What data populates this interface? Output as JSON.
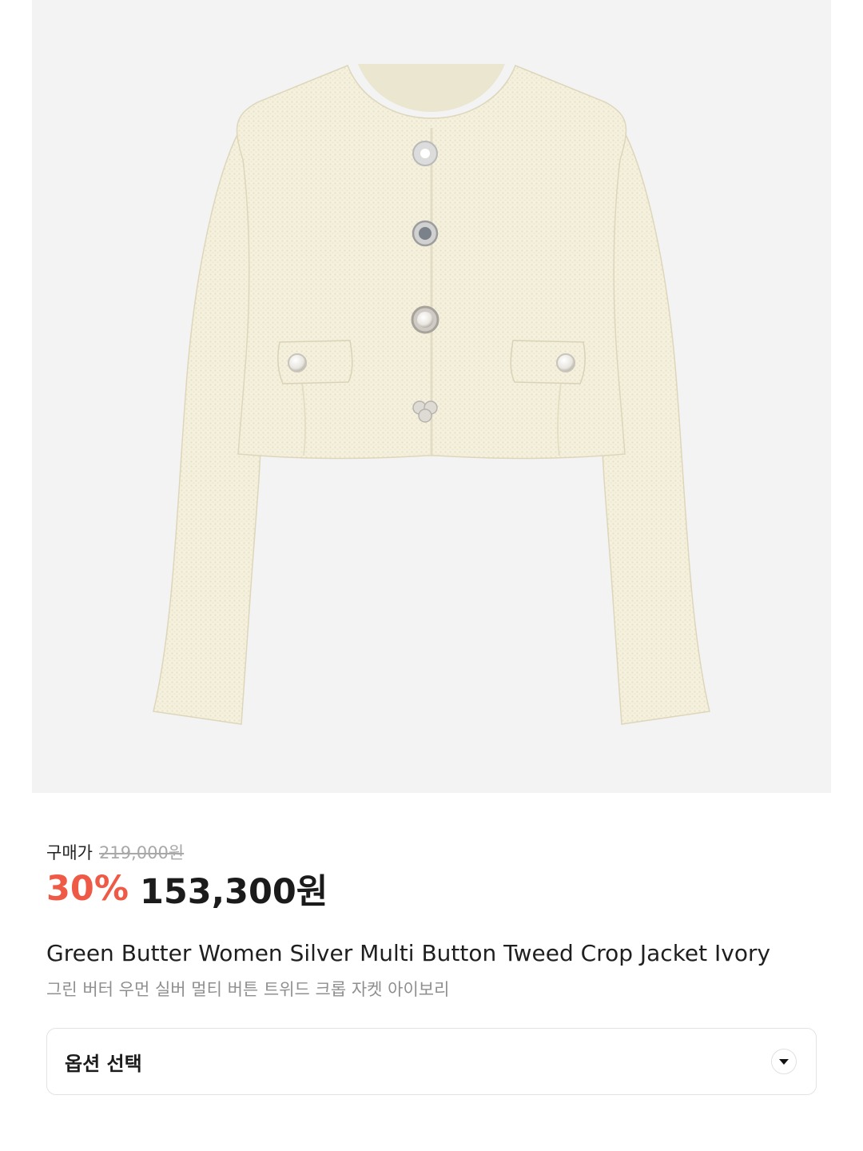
{
  "product": {
    "image_alt": "Ivory tweed crop jacket with silver buttons"
  },
  "pricing": {
    "label": "구매가",
    "original_price": "219,000원",
    "discount": "30%",
    "sale_price": "153,300원"
  },
  "names": {
    "english": "Green Butter Women Silver Multi Button Tweed Crop Jacket Ivory",
    "korean": "그린 버터 우먼 실버 멀티 버튼 트위드 크롭 자켓 아이보리"
  },
  "option": {
    "label": "옵션 선택",
    "icon": "chevron-down-icon"
  },
  "colors": {
    "discount": "#ef5a46",
    "image_bg": "#f3f3f3"
  }
}
